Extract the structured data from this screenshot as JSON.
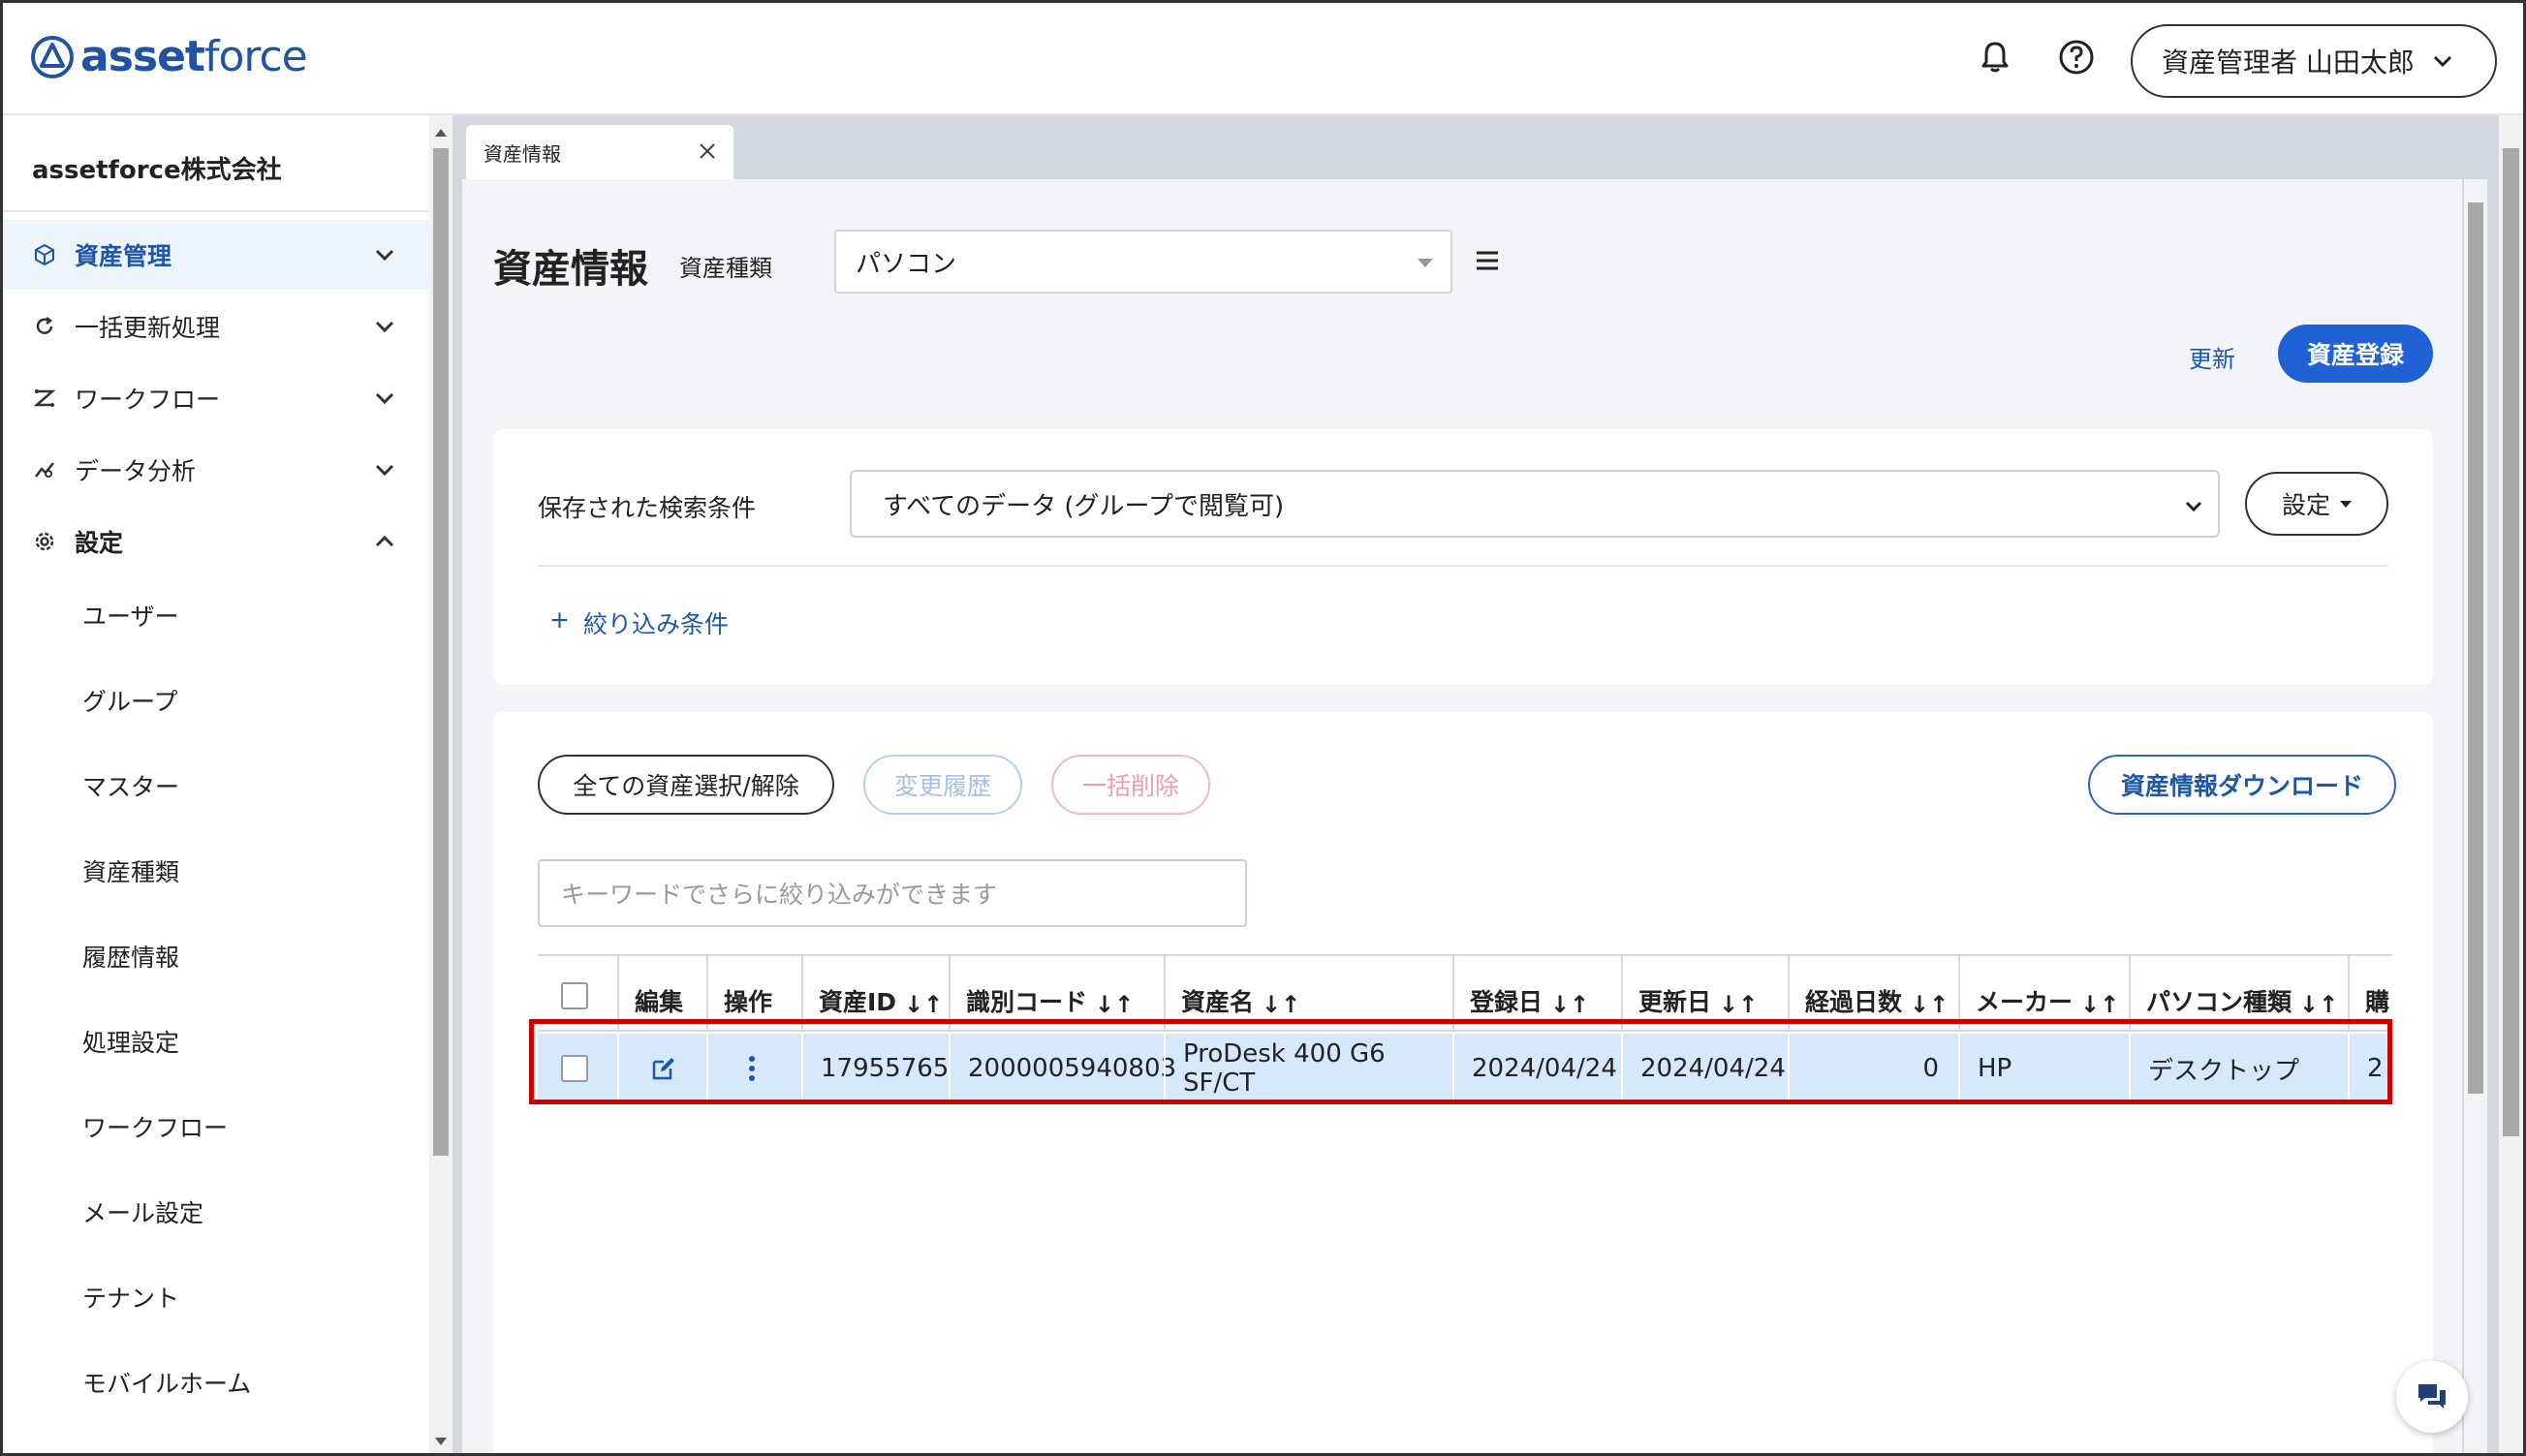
{
  "header": {
    "logo_bold": "asset",
    "logo_light": "force",
    "user_label": "資産管理者 山田太郎"
  },
  "sidebar": {
    "company": "assetforce株式会社",
    "nav": [
      {
        "label": "資産管理",
        "icon": "cube-icon",
        "active": true,
        "chevron": "down"
      },
      {
        "label": "一括更新処理",
        "icon": "refresh-icon",
        "active": false,
        "chevron": "down"
      },
      {
        "label": "ワークフロー",
        "icon": "workflow-icon",
        "active": false,
        "chevron": "down"
      },
      {
        "label": "データ分析",
        "icon": "analytics-icon",
        "active": false,
        "chevron": "down"
      },
      {
        "label": "設定",
        "icon": "gear-icon",
        "active": false,
        "chevron": "up"
      }
    ],
    "sub_items": [
      "ユーザー",
      "グループ",
      "マスター",
      "資産種類",
      "履歴情報",
      "処理設定",
      "ワークフロー",
      "メール設定",
      "テナント",
      "モバイルホーム"
    ]
  },
  "tab": {
    "label": "資産情報"
  },
  "page": {
    "title": "資産情報",
    "type_label": "資産種類",
    "type_value": "パソコン",
    "refresh_label": "更新",
    "register_label": "資産登録"
  },
  "search": {
    "saved_label": "保存された検索条件",
    "saved_value": "すべてのデータ (グループで閲覧可)",
    "settings_label": "設定",
    "filter_label": "絞り込み条件"
  },
  "actions": {
    "select_all": "全ての資産選択/解除",
    "history": "変更履歴",
    "bulk_delete": "一括削除",
    "download": "資産情報ダウンロード",
    "keyword_placeholder": "キーワードでさらに絞り込みができます"
  },
  "table": {
    "headers": [
      "編集",
      "操作",
      "資産ID",
      "識別コード",
      "資産名",
      "登録日",
      "更新日",
      "経過日数",
      "メーカー",
      "パソコン種類",
      "購"
    ],
    "row": {
      "asset_id": "17955765",
      "code": "2000005940803",
      "name": "ProDesk 400 G6 SF/CT",
      "registered": "2024/04/24",
      "updated": "2024/04/24",
      "days": "0",
      "maker": "HP",
      "pc_type": "デスクトップ",
      "extra": "2"
    }
  },
  "colors": {
    "accent": "#1f62d6",
    "link": "#1f57a8",
    "highlight": "#cc0000",
    "row_selected": "#d6e9fb"
  }
}
